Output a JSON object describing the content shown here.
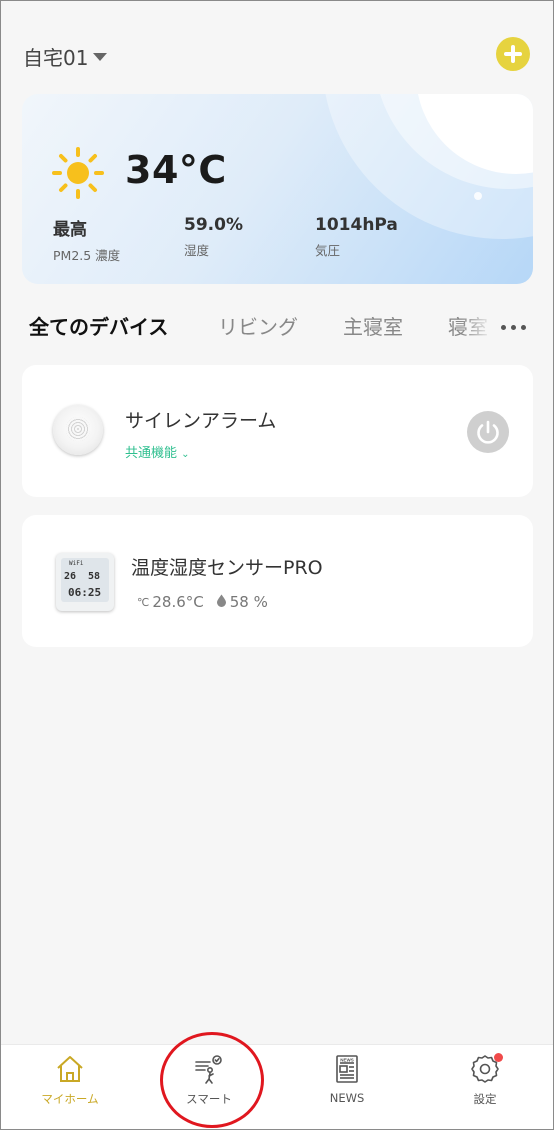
{
  "header": {
    "home_name": "自宅01"
  },
  "weather": {
    "temperature": "34°C",
    "stats": [
      {
        "value": "最高",
        "label": "PM2.5 濃度"
      },
      {
        "value": "59.0%",
        "label": "湿度"
      },
      {
        "value": "1014hPa",
        "label": "気圧"
      }
    ],
    "icon": "sun-icon"
  },
  "tabs": [
    {
      "label": "全てのデバイス",
      "active": true
    },
    {
      "label": "リビング",
      "active": false
    },
    {
      "label": "主寝室",
      "active": false
    },
    {
      "label": "寝室",
      "active": false
    }
  ],
  "devices": [
    {
      "name": "サイレンアラーム",
      "sub_label": "共通機能",
      "thumbnail": "siren-device",
      "power_icon": "power-icon"
    },
    {
      "name": "温度湿度センサーPRO",
      "temperature": "28.6°C",
      "humidity": "58 %",
      "thumbnail": "thermo-hygrometer-device",
      "screen": {
        "wifi": "WiFi",
        "temp": "26",
        "hum": "58",
        "time": "06:25"
      }
    }
  ],
  "bottom_nav": [
    {
      "label": "マイホーム",
      "icon": "home-icon",
      "active": true
    },
    {
      "label": "スマート",
      "icon": "smart-scene-icon",
      "active": false
    },
    {
      "label": "NEWS",
      "icon": "news-icon",
      "active": false
    },
    {
      "label": "設定",
      "icon": "settings-gear-icon",
      "active": false,
      "badge": true
    }
  ],
  "colors": {
    "accent_yellow": "#e6d33f",
    "active_nav": "#c9a825",
    "common_func_green": "#2fbf8f",
    "annotation_red": "#e0171f"
  }
}
